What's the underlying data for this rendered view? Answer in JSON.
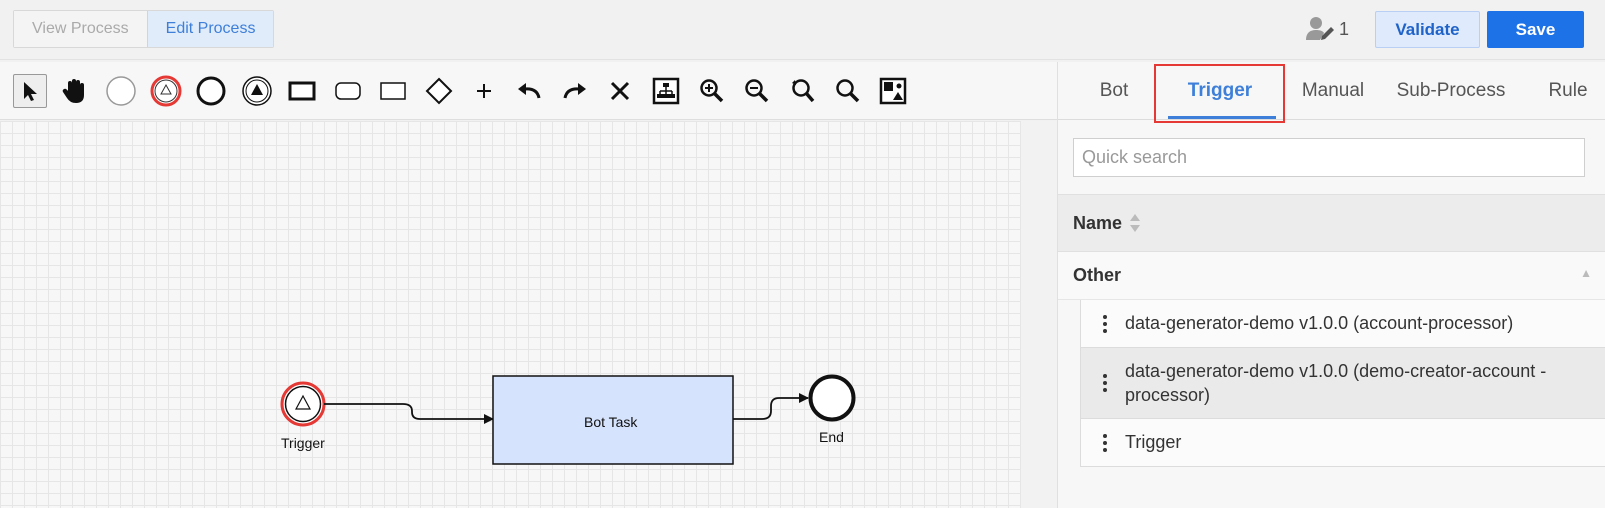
{
  "header": {
    "view_process_label": "View Process",
    "edit_process_label": "Edit Process",
    "user_count": "1",
    "validate_label": "Validate",
    "save_label": "Save"
  },
  "toolbar": {
    "tools": [
      "pointer-icon",
      "hand-icon",
      "start-event-icon",
      "trigger-start-event-icon",
      "end-event-icon",
      "signal-event-icon",
      "task-icon",
      "rounded-task-icon",
      "subprocess-icon",
      "gateway-icon",
      "add-icon",
      "undo-icon",
      "redo-icon",
      "delete-icon",
      "auto-layout-icon",
      "zoom-in-icon",
      "zoom-out-icon",
      "zoom-reset-icon",
      "zoom-fit-icon",
      "minimap-icon"
    ]
  },
  "diagram": {
    "trigger_label": "Trigger",
    "task_label": "Bot Task",
    "end_label": "End",
    "task_fill": "#d6e3fc",
    "trigger_ring_color": "#e53935"
  },
  "panel": {
    "tabs": [
      {
        "label": "Bot"
      },
      {
        "label": "Trigger"
      },
      {
        "label": "Manual"
      },
      {
        "label": "Sub-Process"
      },
      {
        "label": "Rule"
      }
    ],
    "active_tab": "Trigger",
    "search_placeholder": "Quick search",
    "column_header": "Name",
    "group_label": "Other",
    "items": [
      {
        "label": "data-generator-demo v1.0.0 (account-processor)"
      },
      {
        "label": "data-generator-demo v1.0.0 (demo-creator-account -processor)"
      },
      {
        "label": "Trigger"
      }
    ]
  },
  "colors": {
    "accent": "#3d7fd9",
    "save_button": "#1e72e8",
    "highlight_box": "#e53935"
  }
}
